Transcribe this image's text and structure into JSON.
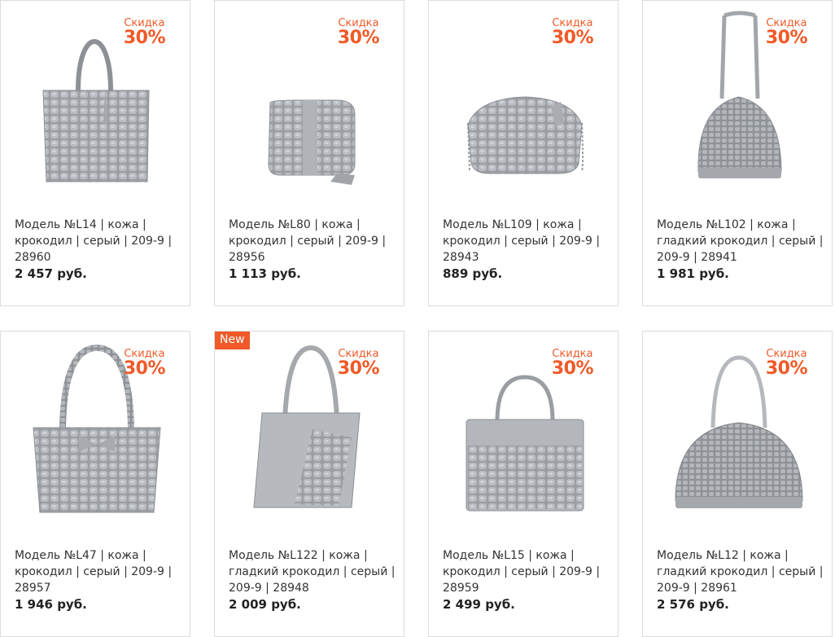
{
  "accent_color": "#f05a28",
  "products": [
    {
      "discount_label": "Скидка",
      "discount_value": "30%",
      "title": "Модель №L14 | кожа | крокодил | серый | 209-9 | 28960",
      "price": "2 457 руб.",
      "image_icon": "handbag-tote-icon"
    },
    {
      "discount_label": "Скидка",
      "discount_value": "30%",
      "title": "Модель №L80 | кожа | крокодил | серый | 209-9 | 28956",
      "price": "1 113 руб.",
      "image_icon": "handbag-crossbody-icon"
    },
    {
      "discount_label": "Скидка",
      "discount_value": "30%",
      "title": "Модель №L109 | кожа | крокодил | серый | 209-9 | 28943",
      "price": "889 руб.",
      "image_icon": "handbag-chain-icon"
    },
    {
      "discount_label": "Скидка",
      "discount_value": "30%",
      "title": "Модель №L102 | кожа | гладкий крокодил | серый | 209-9 | 28941",
      "price": "1 981 руб.",
      "image_icon": "handbag-dome-icon"
    },
    {
      "discount_label": "Скидка",
      "discount_value": "30%",
      "title": "Модель №L47 | кожа | крокодил | серый | 209-9 | 28957",
      "price": "1 946 руб.",
      "image_icon": "handbag-bow-icon"
    },
    {
      "badge": "New",
      "discount_label": "Скидка",
      "discount_value": "30%",
      "title": "Модель №L122 | кожа | гладкий крокодил | серый | 209-9 | 28948",
      "price": "2 009 руб.",
      "image_icon": "handbag-trapeze-icon"
    },
    {
      "discount_label": "Скидка",
      "discount_value": "30%",
      "title": "Модель №L15 | кожа | крокодил | серый | 209-9 | 28959",
      "price": "2 499 руб.",
      "image_icon": "handbag-structured-icon"
    },
    {
      "discount_label": "Скидка",
      "discount_value": "30%",
      "title": "Модель №L12 | кожа | гладкий крокодил | серый | 209-9 | 28961",
      "price": "2 576 руб.",
      "image_icon": "handbag-bowling-icon"
    }
  ]
}
